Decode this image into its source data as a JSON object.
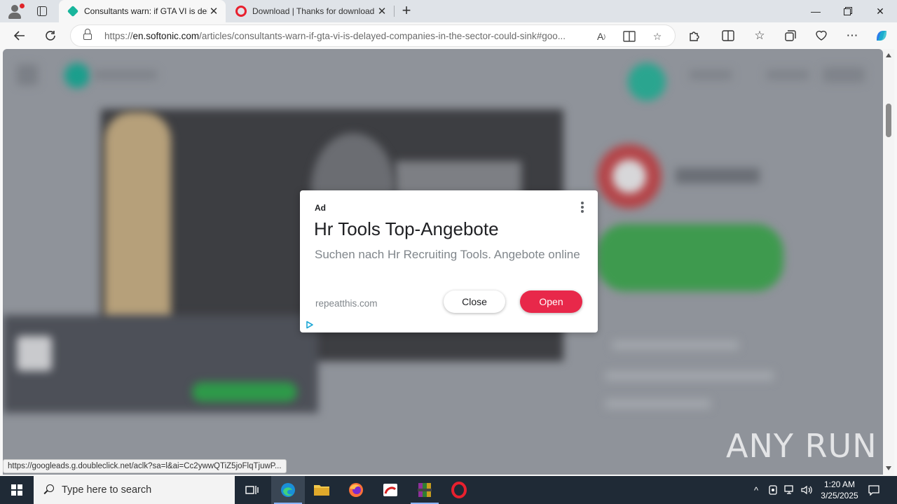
{
  "browser": {
    "tabs": [
      {
        "title": "Consultants warn: if GTA VI is del",
        "active": true,
        "favicon": "softonic-icon"
      },
      {
        "title": "Download | Thanks for download",
        "active": false,
        "favicon": "opera-icon"
      }
    ],
    "url_prefix": "https://",
    "url_host": "en.softonic.com",
    "url_path": "/articles/consultants-warn-if-gta-vi-is-delayed-companies-in-the-sector-could-sink#goo..."
  },
  "ad": {
    "label": "Ad",
    "headline": "Hr Tools Top-Angebote",
    "description": "Suchen nach Hr Recruiting Tools. Angebote online",
    "domain": "repeatthis.com",
    "close_label": "Close",
    "open_label": "Open"
  },
  "status_link": "https://googleads.g.doubleclick.net/aclk?sa=l&ai=Cc2ywwQTiZ5joFlqTjuwP...",
  "watermark": "ANY RUN",
  "taskbar": {
    "search_placeholder": "Type here to search",
    "time": "1:20 AM",
    "date": "3/25/2025"
  },
  "colors": {
    "open_button": "#e8284a",
    "taskbar": "#1f2a36",
    "page_overlay": "#8f939a"
  }
}
